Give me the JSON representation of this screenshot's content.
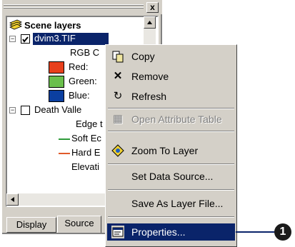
{
  "toc": {
    "close_glyph": "x",
    "root_label": "Scene layers",
    "layer1": {
      "name": "dvim3.TIF",
      "sub_label": "RGB C",
      "bands": [
        {
          "label": "Red:",
          "color": "#e8401c"
        },
        {
          "label": "Green:",
          "color": "#6abf4b"
        },
        {
          "label": "Blue:",
          "color": "#0b3fa0"
        }
      ]
    },
    "layer2": {
      "name": "Death Valle",
      "sub_label": "Edge t",
      "lines": [
        {
          "label": "Soft Ec",
          "color": "#2e9b3a"
        },
        {
          "label": "Hard E",
          "color": "#e05a2a"
        }
      ],
      "trailing_label": "Elevati"
    },
    "tabs": [
      "Display",
      "Source"
    ]
  },
  "menu": {
    "items": [
      {
        "label": "Copy",
        "icon": "copy-icon",
        "glyph": "⧉"
      },
      {
        "label": "Remove",
        "icon": "remove-icon",
        "glyph": "✕"
      },
      {
        "label": "Refresh",
        "icon": "refresh-icon",
        "glyph": "↻"
      },
      {
        "label": "Open Attribute Table",
        "icon": "table-icon",
        "glyph": "▦"
      },
      {
        "label": "Zoom To Layer",
        "icon": "zoom-to-layer-icon",
        "glyph": "⊕"
      },
      {
        "label": "Set Data Source...",
        "icon": "",
        "glyph": ""
      },
      {
        "label": "Save As Layer File...",
        "icon": "",
        "glyph": ""
      },
      {
        "label": "Properties...",
        "icon": "properties-icon",
        "glyph": "▤"
      }
    ]
  },
  "callout": {
    "number": "1"
  },
  "colors": {
    "selection": "#0a246a",
    "face": "#d4d0c8"
  }
}
